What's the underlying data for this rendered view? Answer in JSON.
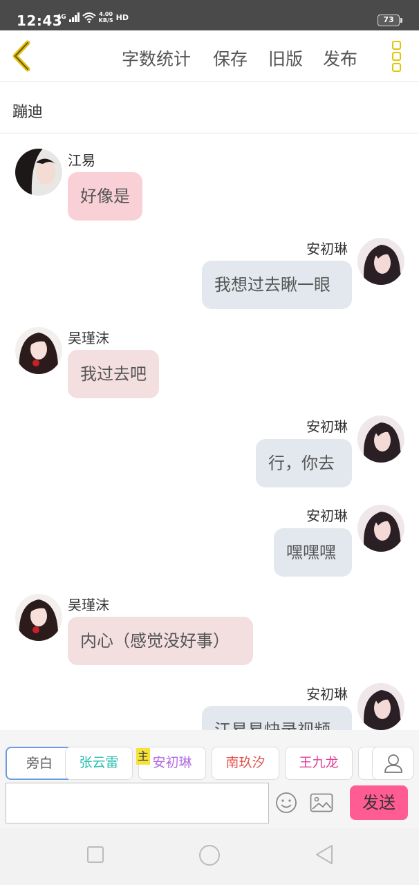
{
  "status_bar": {
    "time": "12:43",
    "network": "4G",
    "speed_value": "4.00",
    "speed_unit": "KB/S",
    "hd": "HD",
    "battery": "73"
  },
  "toolbar": {
    "word_count": "字数统计",
    "save": "保存",
    "old_version": "旧版",
    "publish": "发布"
  },
  "title": "蹦迪",
  "messages": [
    {
      "name": "江易",
      "text": "好像是"
    },
    {
      "name": "安初琳",
      "text": "我想过去瞅一眼"
    },
    {
      "name": "吴瑾沫",
      "text": "我过去吧"
    },
    {
      "name": "安初琳",
      "text": "行，你去"
    },
    {
      "name": "安初琳",
      "text": "嘿嘿嘿"
    },
    {
      "name": "吴瑾沫",
      "text": "内心（感觉没好事）"
    },
    {
      "name": "安初琳",
      "text": "江易易快录视频"
    }
  ],
  "roles": {
    "narration": "旁白",
    "items": [
      "张云雷",
      "安初琳",
      "南玖汐",
      "王九龙"
    ],
    "colors": [
      "#2bbfb0",
      "#b36be0",
      "#e0524a",
      "#e0409a"
    ],
    "master_badge": "主"
  },
  "composer": {
    "input_value": "",
    "send": "发送"
  }
}
